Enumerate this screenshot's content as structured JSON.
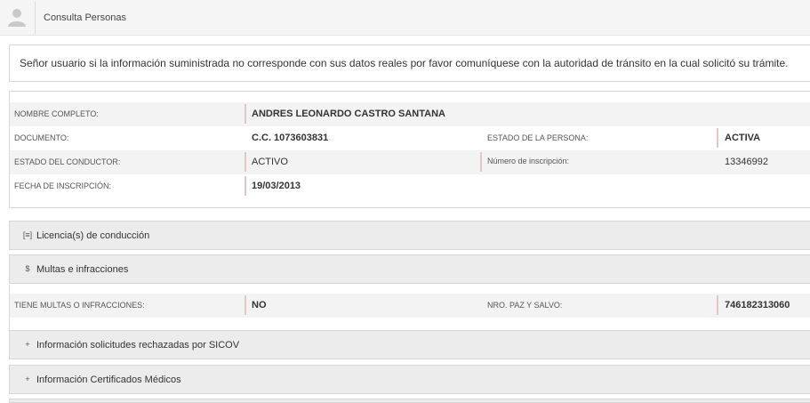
{
  "header": {
    "title": "Consulta Personas",
    "icon": "user-icon"
  },
  "notice": {
    "text": "Señor usuario si la información suministrada no corresponde con sus datos reales por favor comuníquese con la autoridad de tránsito en la cual solicitó su trámite."
  },
  "person": {
    "full_name_label": "NOMBRE COMPLETO:",
    "full_name": "ANDRES LEONARDO CASTRO SANTANA",
    "document_label": "DOCUMENTO:",
    "document": "C.C. 1073603831",
    "person_status_label": "ESTADO DE LA PERSONA:",
    "person_status": "ACTIVA",
    "driver_status_label": "ESTADO DEL CONDUCTOR:",
    "driver_status": "ACTIVO",
    "registration_number_label": "Número de inscripción:",
    "registration_number": "13346992",
    "registration_date_label": "FECHA DE INSCRIPCIÓN:",
    "registration_date": "19/03/2013"
  },
  "panels": {
    "licenses": {
      "title": "Licencia(s) de conducción",
      "icon": "license-icon",
      "icon_glyph": "[≡]"
    },
    "fines": {
      "title": "Multas e infracciones",
      "icon": "dollar-icon",
      "icon_glyph": "$"
    },
    "sicov": {
      "title": "Información solicitudes rechazadas por SICOV",
      "icon": "plus-icon",
      "icon_glyph": "+"
    },
    "medical": {
      "title": "Información Certificados Médicos",
      "icon": "plus-icon",
      "icon_glyph": "+"
    }
  },
  "fines": {
    "has_fines_label": "TIENE MULTAS O INFRACCIONES:",
    "has_fines": "NO",
    "clearance_label": "NRO. PAZ Y SALVO:",
    "clearance_number": "746182313060"
  },
  "colors": {
    "accent_bar": "#e3c5c5",
    "panel_bg": "#ececec",
    "row_shade": "#f3f3f3"
  }
}
